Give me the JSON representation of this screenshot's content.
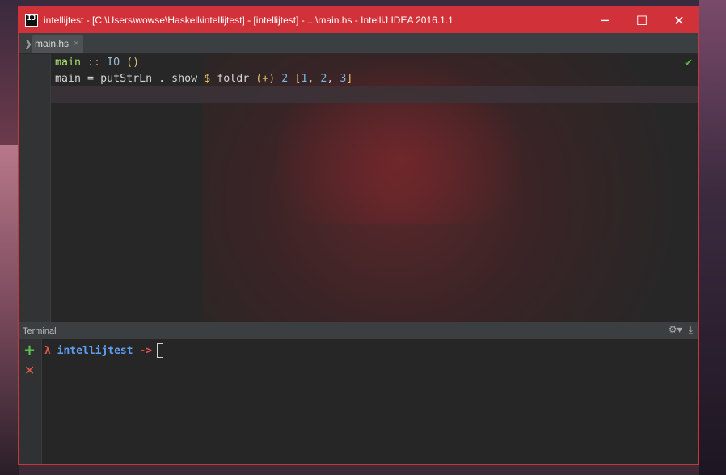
{
  "window": {
    "title": "intellijtest - [C:\\Users\\wowse\\Haskell\\intellijtest] - [intellijtest] - ...\\main.hs - IntelliJ IDEA 2016.1.1",
    "app_icon_label": "IJ",
    "controls": {
      "minimize": "─",
      "maximize": "☐",
      "close": "✕"
    },
    "accent": "#d1323a"
  },
  "tabs": [
    {
      "label": "main.hs",
      "close": "×"
    }
  ],
  "editor": {
    "lines": [
      {
        "tokens": [
          {
            "text": "main",
            "kind": "fn"
          },
          {
            "text": " ",
            "kind": "plain"
          },
          {
            "text": "::",
            "kind": "op"
          },
          {
            "text": " ",
            "kind": "plain"
          },
          {
            "text": "IO",
            "kind": "type"
          },
          {
            "text": " ",
            "kind": "plain"
          },
          {
            "text": "()",
            "kind": "paren"
          }
        ]
      },
      {
        "tokens": [
          {
            "text": "main",
            "kind": "plain"
          },
          {
            "text": " ",
            "kind": "plain"
          },
          {
            "text": "=",
            "kind": "plain"
          },
          {
            "text": " putStrLn ",
            "kind": "plain"
          },
          {
            "text": ".",
            "kind": "plain"
          },
          {
            "text": " show ",
            "kind": "plain"
          },
          {
            "text": "$",
            "kind": "dollar"
          },
          {
            "text": " foldr ",
            "kind": "plain"
          },
          {
            "text": "(+)",
            "kind": "paren"
          },
          {
            "text": " ",
            "kind": "plain"
          },
          {
            "text": "2",
            "kind": "num"
          },
          {
            "text": " ",
            "kind": "plain"
          },
          {
            "text": "[",
            "kind": "paren"
          },
          {
            "text": "1",
            "kind": "num"
          },
          {
            "text": ", ",
            "kind": "plain"
          },
          {
            "text": "2",
            "kind": "num"
          },
          {
            "text": ", ",
            "kind": "plain"
          },
          {
            "text": "3",
            "kind": "num"
          },
          {
            "text": "]",
            "kind": "paren"
          }
        ]
      }
    ],
    "status_check": "✔"
  },
  "terminal": {
    "title": "Terminal",
    "settings_icon": "⚙▾",
    "hide_icon": "⤓",
    "add": "+",
    "close": "✕",
    "prompt": {
      "lambda": "λ",
      "project": "intellijtest",
      "arrow": "->"
    }
  }
}
